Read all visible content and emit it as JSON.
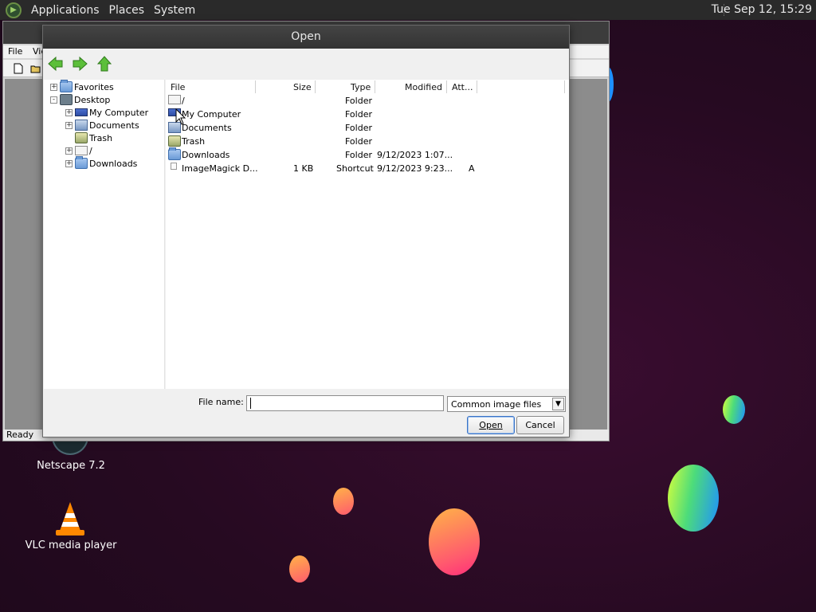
{
  "panel": {
    "menus": [
      "Applications",
      "Places",
      "System"
    ],
    "clock": "Tue Sep 12, 15:29"
  },
  "desktop_icons": [
    {
      "label": "Netscape 7.2",
      "icon": "netscape-icon"
    },
    {
      "label": "VLC media player",
      "icon": "vlc-cone-icon"
    }
  ],
  "background_window": {
    "menus": [
      "File",
      "Vie"
    ],
    "status": "Ready"
  },
  "dialog": {
    "title": "Open",
    "nav": {
      "back": "back-arrow-icon",
      "forward": "forward-arrow-icon",
      "up": "up-arrow-icon"
    },
    "tree": [
      {
        "label": "Favorites",
        "icon": "folder-icon",
        "expander": "+"
      },
      {
        "label": "Desktop",
        "icon": "desktop-icon",
        "expander": "-"
      },
      {
        "label": "My Computer",
        "icon": "computer-icon",
        "expander": "+"
      },
      {
        "label": "Documents",
        "icon": "documents-icon",
        "expander": "+"
      },
      {
        "label": "Trash",
        "icon": "trash-icon",
        "expander": ""
      },
      {
        "label": "/",
        "icon": "drive-icon",
        "expander": "+"
      },
      {
        "label": "Downloads",
        "icon": "folder-icon",
        "expander": "+"
      }
    ],
    "columns": [
      "File",
      "Size",
      "Type",
      "Modified",
      "Att..."
    ],
    "files": [
      {
        "name": "/",
        "size": "",
        "type": "Folder",
        "modified": "",
        "attr": "",
        "icon": "drive-icon"
      },
      {
        "name": "My Computer",
        "size": "",
        "type": "Folder",
        "modified": "",
        "attr": "",
        "icon": "computer-icon"
      },
      {
        "name": "Documents",
        "size": "",
        "type": "Folder",
        "modified": "",
        "attr": "",
        "icon": "documents-icon"
      },
      {
        "name": "Trash",
        "size": "",
        "type": "Folder",
        "modified": "",
        "attr": "",
        "icon": "trash-icon"
      },
      {
        "name": "Downloads",
        "size": "",
        "type": "Folder",
        "modified": "9/12/2023 1:07...",
        "attr": "",
        "icon": "folder-icon"
      },
      {
        "name": "ImageMagick D...",
        "size": "1 KB",
        "type": "Shortcut",
        "modified": "9/12/2023 9:23...",
        "attr": "A",
        "icon": "shortcut-icon"
      }
    ],
    "file_name_label": "File name:",
    "file_name_value": "",
    "filter": "Common image files",
    "open_label": "Open",
    "cancel_label": "Cancel"
  }
}
